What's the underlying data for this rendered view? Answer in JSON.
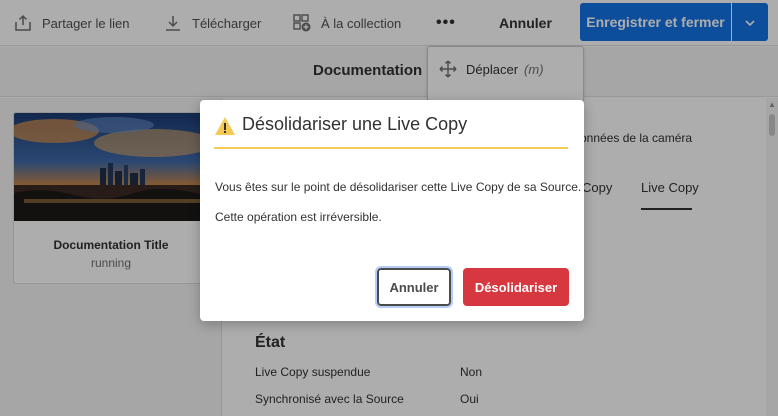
{
  "toolbar": {
    "share_label": "Partager le lien",
    "download_label": "Télécharger",
    "collection_label": "À la collection",
    "more_label": "•••",
    "cancel_label": "Annuler",
    "save_label": "Enregistrer et fermer",
    "colors": {
      "primary": "#1473e6"
    }
  },
  "header": {
    "title": "Documentation"
  },
  "menu": {
    "items": [
      {
        "label": "Déplacer",
        "shortcut": "(m)",
        "icon": "move-icon"
      }
    ]
  },
  "card": {
    "title": "Documentation Title",
    "subtitle": "running",
    "thumbnail": "city-skyline-image"
  },
  "background": {
    "camera_text": "onnées de la caméra",
    "tab_1": "Copy",
    "tab_2": "Live Copy",
    "section_heading": "État",
    "rows": [
      {
        "label": "Live Copy suspendue",
        "value": "Non"
      },
      {
        "label": "Synchronisé avec la Source",
        "value": "Oui"
      }
    ]
  },
  "dialog": {
    "title": "Désolidariser une Live Copy",
    "body_line_1": "Vous êtes sur le point de désolidariser cette Live Copy de sa Source.",
    "body_line_2": "Cette opération est irréversible.",
    "cancel_label": "Annuler",
    "confirm_label": "Désolidariser",
    "colors": {
      "warning": "#f5c955",
      "danger": "#d7373f"
    }
  }
}
